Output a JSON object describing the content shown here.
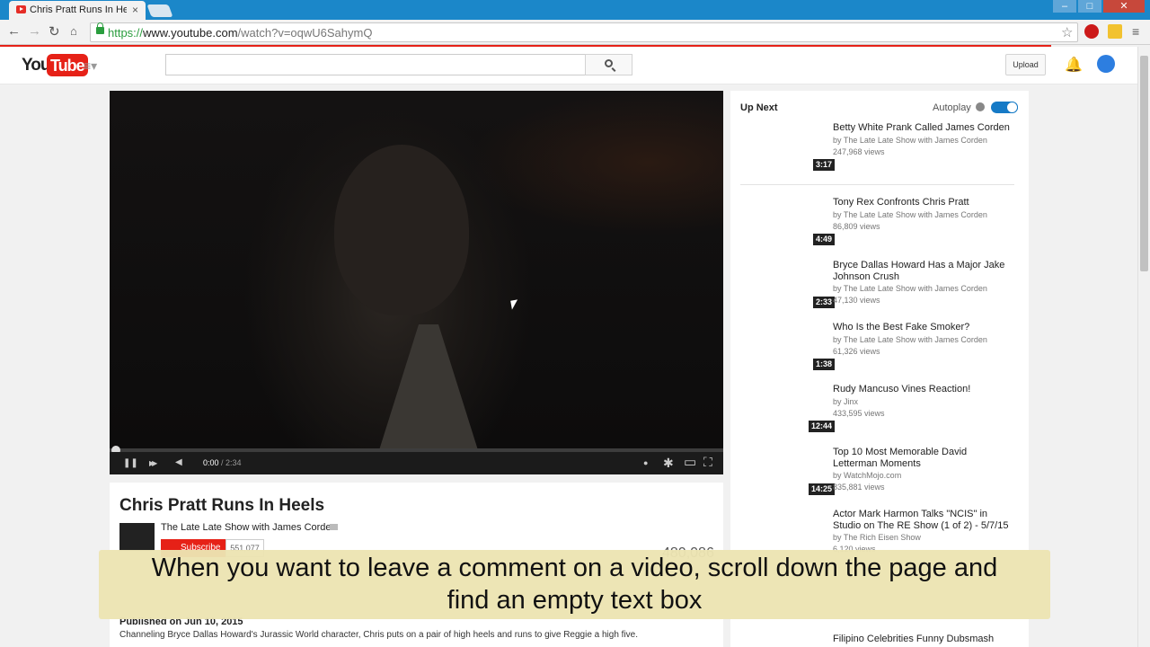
{
  "browser": {
    "tab_title": "Chris Pratt Runs In Heels",
    "tab_close": "×",
    "url_scheme": "https://",
    "url_host": "www.youtube.com",
    "url_path": "/watch?v=oqwU6SahymQ",
    "window_controls": {
      "minimize": "–",
      "maximize": "□",
      "close": "✕"
    },
    "back_icon": "←",
    "forward_icon": "→",
    "reload_icon": "↻",
    "star_icon": "☆"
  },
  "header": {
    "logo_you": "You",
    "logo_tube": "Tube",
    "guide_icon": "≡▾",
    "search_placeholder": "",
    "upload_label": "Upload",
    "bell_icon": "🔔"
  },
  "player": {
    "current_time": "0:00",
    "separator": " / ",
    "duration": "2:34",
    "progress": 0,
    "icons": {
      "pause": "❚❚",
      "next": "▶▶",
      "volume": "◀",
      "annotations": "●",
      "settings": "✱",
      "theater": "▭",
      "fullscreen": "⛶"
    }
  },
  "video": {
    "title": "Chris Pratt Runs In Heels",
    "channel": "The Late Late Show with James Corden",
    "subscribe_label": "Subscribe",
    "subscriber_count": "551,077",
    "view_count": "480,086",
    "published": "Published on Jun 10, 2015",
    "description": "Channeling Bryce Dallas Howard's Jurassic World character, Chris puts on a pair of high heels and runs to give Reggie a high five."
  },
  "sidebar": {
    "up_next_label": "Up Next",
    "autoplay_label": "Autoplay",
    "autoplay_on": true,
    "items": [
      {
        "title": "Betty White Prank Called James Corden",
        "channel": "by The Late Late Show with James Corden",
        "views": "247,968 views",
        "duration": "3:17"
      },
      {
        "title": "Tony Rex Confronts Chris Pratt",
        "channel": "by The Late Late Show with James Corden",
        "views": "86,809 views",
        "duration": "4:49"
      },
      {
        "title": "Bryce Dallas Howard Has a Major Jake Johnson Crush",
        "channel": "by The Late Late Show with James Corden",
        "views": "47,130 views",
        "duration": "2:33"
      },
      {
        "title": "Who Is the Best Fake Smoker?",
        "channel": "by The Late Late Show with James Corden",
        "views": "61,326 views",
        "duration": "1:38"
      },
      {
        "title": "Rudy Mancuso Vines Reaction!",
        "channel": "by Jinx",
        "views": "433,595 views",
        "duration": "12:44"
      },
      {
        "title": "Top 10 Most Memorable David Letterman Moments",
        "channel": "by WatchMojo.com",
        "views": "835,881 views",
        "duration": "14:25"
      },
      {
        "title": "Actor Mark Harmon Talks \"NCIS\" in Studio on The RE Show (1 of 2) - 5/7/15",
        "channel": "by The Rich Eisen Show",
        "views": "6,120 views",
        "duration": ""
      },
      {
        "title": "Filipino Celebrities Funny Dubsmash",
        "channel": "",
        "views": "",
        "duration": ""
      }
    ]
  },
  "caption": {
    "line1": "When you want to leave a comment on a video, scroll down the page and",
    "line2": "find an empty text box"
  }
}
